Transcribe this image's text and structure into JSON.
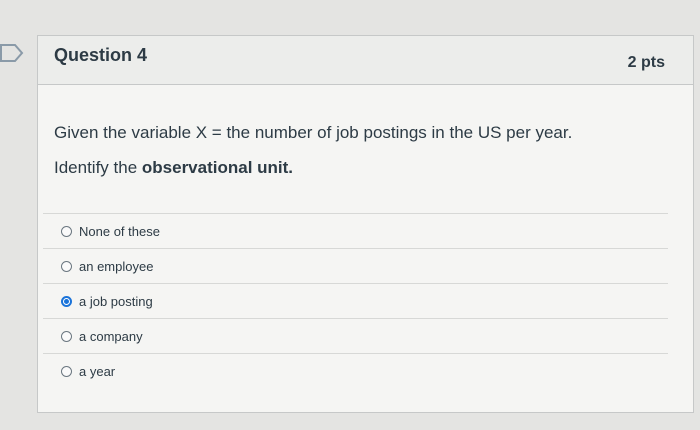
{
  "question": {
    "title": "Question 4",
    "points": "2 pts",
    "text": "Given the variable X = the number of job postings in the US per year.",
    "prompt_prefix": "Identify the ",
    "prompt_bold": "observational unit.",
    "answers": [
      {
        "label": "None of these",
        "selected": false
      },
      {
        "label": "an employee",
        "selected": false
      },
      {
        "label": "a job posting",
        "selected": true
      },
      {
        "label": "a company",
        "selected": false
      },
      {
        "label": "a year",
        "selected": false
      }
    ]
  },
  "colors": {
    "accent": "#1a73d9",
    "flag": "#8a9aa8"
  }
}
